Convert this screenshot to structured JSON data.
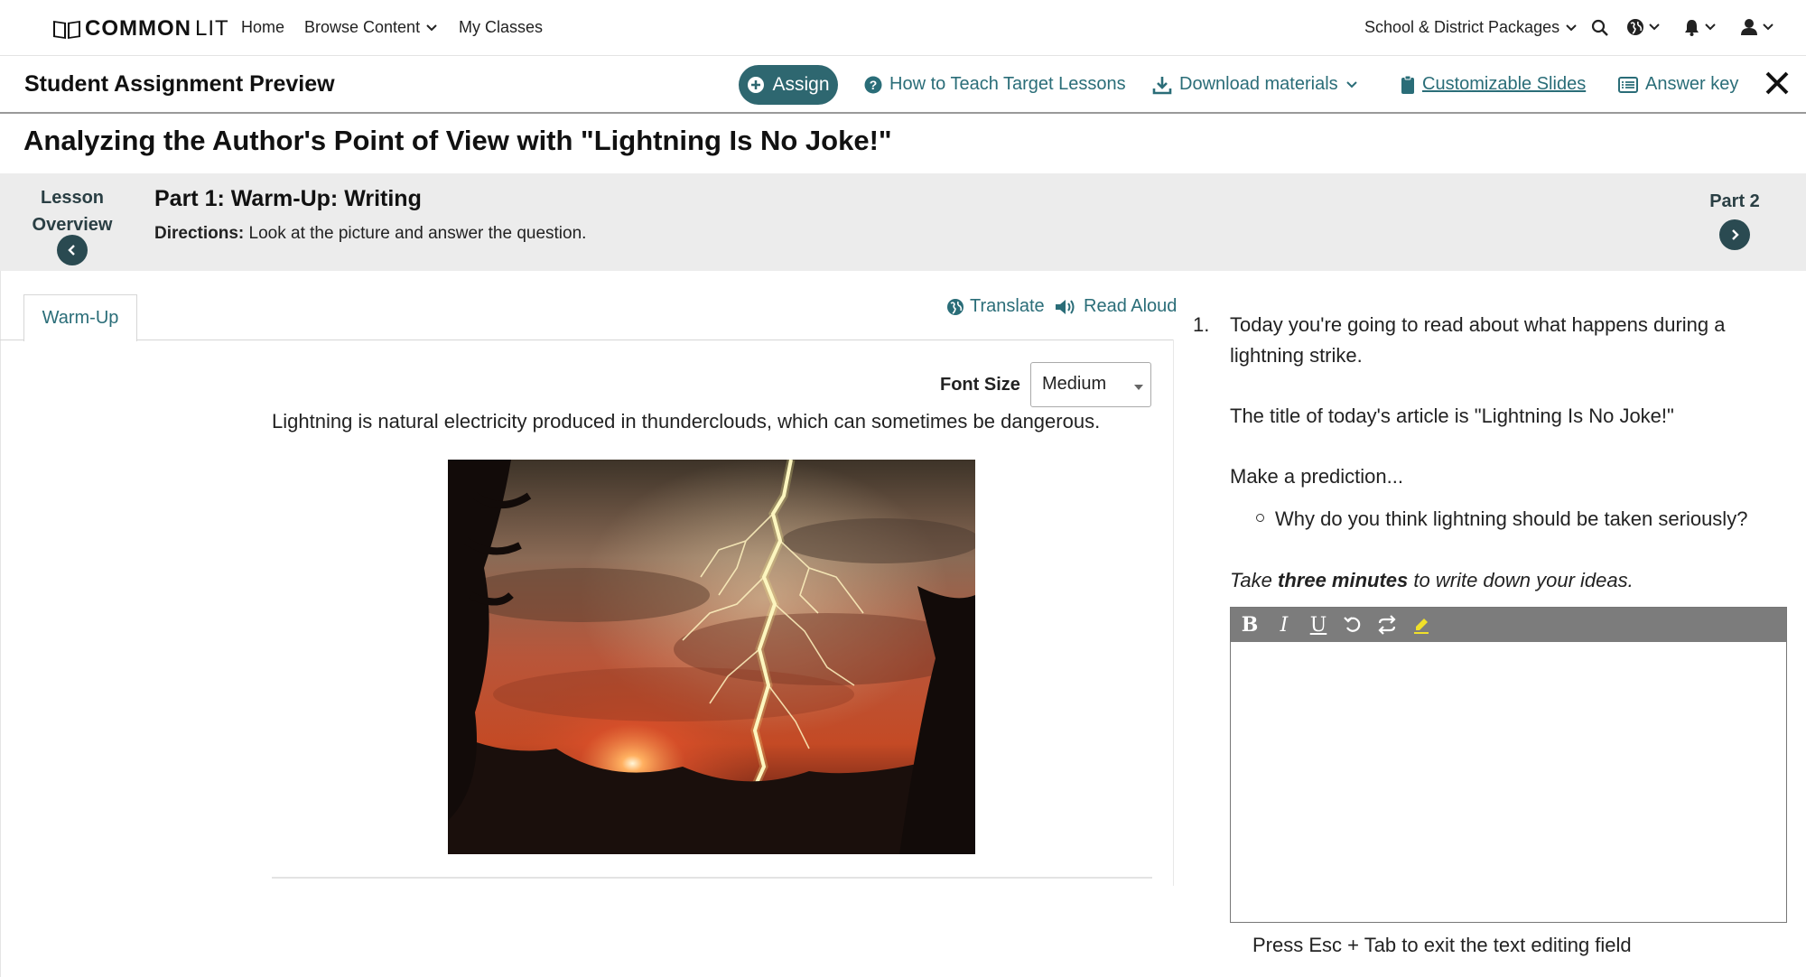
{
  "nav": {
    "logo_bold": "COMMON",
    "logo_light": "LIT",
    "home": "Home",
    "browse": "Browse Content",
    "classes": "My Classes",
    "packages": "School & District Packages"
  },
  "header": {
    "title": "Student Assignment Preview",
    "assign": "Assign",
    "how_to": "How to Teach Target Lessons",
    "download": "Download materials",
    "slides": "Customizable Slides",
    "answer_key": "Answer key"
  },
  "lesson": {
    "title": "Analyzing the Author's Point of View with \"Lightning Is No Joke!\"",
    "overview_label": "Lesson Overview",
    "part_title": "Part 1: Warm-Up: Writing",
    "directions_label": "Directions:",
    "directions_text": " Look at the picture and answer the question.",
    "next_part": "Part 2"
  },
  "left_pane": {
    "tab": "Warm-Up",
    "translate": "Translate",
    "read_aloud": "Read Aloud",
    "font_size_label": "Font Size",
    "font_size_value": "Medium",
    "caption": "Lightning is natural electricity produced in thunderclouds, which can sometimes be dangerous."
  },
  "question": {
    "number": "1.",
    "line1": "Today you're going to read about what happens during a",
    "line2": "lightning strike.",
    "title_line": "The title of today's article is \"Lightning Is No Joke!\"",
    "prediction": "Make a prediction...",
    "bullet": "Why do you think lightning should be taken seriously?",
    "instr_pre": "Take ",
    "instr_bold": "three minutes",
    "instr_post": " to write down your ideas.",
    "editor_note": "Press Esc + Tab to exit the text editing field"
  },
  "colors": {
    "accent": "#2a6d78",
    "assign_bg": "#2e6770",
    "partbar_bg": "#ececec",
    "toolbar_bg": "#7c7c7c"
  }
}
